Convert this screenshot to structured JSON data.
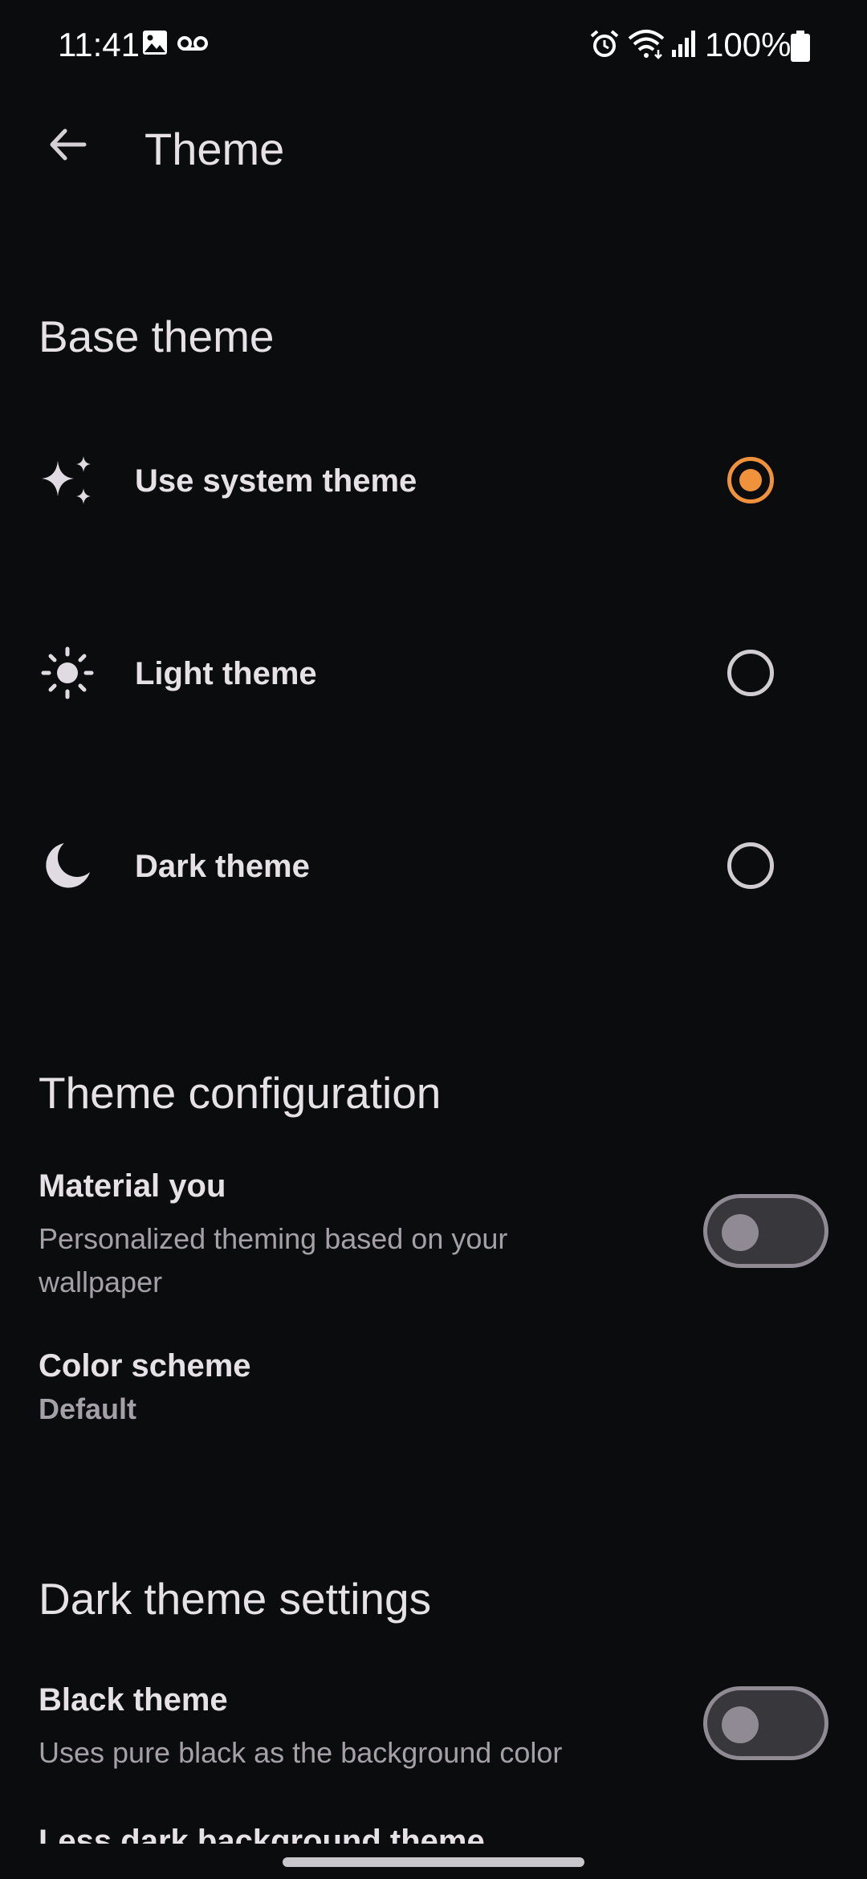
{
  "status_bar": {
    "time": "11:41",
    "battery": "100%",
    "icons": [
      "gallery-icon",
      "voicemail-icon",
      "alarm-icon",
      "wifi-icon",
      "signal-icon",
      "battery-icon"
    ]
  },
  "app_bar": {
    "title": "Theme",
    "back_icon": "arrow-back-icon"
  },
  "base_theme": {
    "header": "Base theme",
    "options": [
      {
        "label": "Use system theme",
        "icon": "auto-sparkle-icon",
        "selected": true
      },
      {
        "label": "Light theme",
        "icon": "sun-icon",
        "selected": false
      },
      {
        "label": "Dark theme",
        "icon": "moon-icon",
        "selected": false
      }
    ]
  },
  "theme_configuration": {
    "header": "Theme configuration",
    "material_you": {
      "title": "Material you",
      "summary": "Personalized theming based on your wallpaper",
      "enabled": false
    },
    "color_scheme": {
      "title": "Color scheme",
      "value": "Default"
    }
  },
  "dark_theme_settings": {
    "header": "Dark theme settings",
    "black_theme": {
      "title": "Black theme",
      "summary": "Uses pure black as the background color",
      "enabled": false
    },
    "next_item_partial": "Less dark background theme"
  },
  "colors": {
    "background": "#0b0c0e",
    "accent": "#f0923c",
    "text_primary": "#e6e1e6",
    "text_secondary": "#a5a0a8"
  }
}
